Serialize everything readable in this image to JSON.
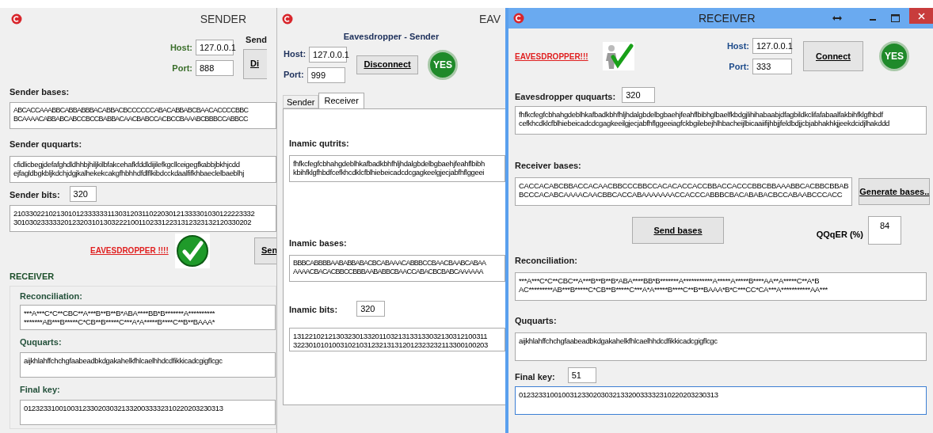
{
  "sender_window": {
    "title": "SENDER",
    "host_label": "Host:",
    "host": "127.0.0.1",
    "port_label": "Port:",
    "port": "888",
    "side_label": "Send",
    "side_button": "Di",
    "bases": {
      "label": "Sender bases:",
      "lines": [
        "ABCACCAAABBCABBABBBACABBACBCCCCCCABACABBABCBAACACCCCBBC",
        "BCAAAACABBABCABCCBCCBABBACAACBABCCACBCCBAAABCBBBCCABBCC"
      ]
    },
    "ququarts": {
      "label": "Sender ququarts:",
      "lines": [
        "cfidlicbegjdefafghdldhhbjhiljkilbfakcehafkfddldijilefkgcllceigegfkabbjbkhjcdd",
        "ejfagldbgkbljkdchjdgjkalhekekcakgfhbhhdfdlflkibdcckdaalfifkhbaeclelbaeblhj"
      ]
    },
    "bits": {
      "label": "Sender bits:",
      "count": "320",
      "lines": [
        "21033022102130101233333311303120311022030121333301030122223332",
        "3010302333332012320310130322210011023312231312323132120330202"
      ]
    },
    "alert": "EAVESDROPPER !!!!",
    "send_button": "Sen",
    "section": "RECEIVER",
    "reconciliation": {
      "label": "Reconciliation:",
      "lines": [
        "***A***C*C**CBC**A***B**B**B*ABA****BB*B*******A**********",
        "*******AB***B*****C*CB**B*****C***A*A*****B****C**B**BAAA*"
      ]
    },
    "ququarts_rx": {
      "label": "Ququarts:",
      "lines": [
        "aijkhlahffchchgfaabeadbkdgakahelkfhlcaelhhdcdfikkicadcgigflcgc"
      ]
    },
    "final_key": {
      "label": "Final key:",
      "lines": [
        "012323310010031233020303213320033332310220203230313"
      ]
    }
  },
  "eavesdropper_window": {
    "title": "EAV",
    "heading": "Eavesdropper - Sender",
    "host_label": "Host:",
    "host": "127.0.0.1",
    "port_label": "Port:",
    "port": "999",
    "button": "Disconnect",
    "badge": "YES",
    "tabs": [
      {
        "label": "Sender",
        "selected": false
      },
      {
        "label": "Receiver",
        "selected": true
      }
    ],
    "qutrits": {
      "label": "Inamic qutrits:",
      "lines": [
        "fhfkcfegfcbhahgdeblhkafbadkbhfhljhdalgbdelbgbaehjfeahflbibh",
        "kbihfklgfhbdfcefkhcdklcfblhiebeicadcdcgagkeelgjecjabfhflggeei"
      ]
    },
    "bases": {
      "label": "Inamic bases:",
      "lines": [
        "BBBCABBBBAABABBABACBCABAAACABBBCCBAACBAABCABAA",
        "AAAACBACACBBCCBBBAABABBCBAACCABACBCBABCAAAAAA"
      ]
    },
    "bits": {
      "label": "Inamic bits:",
      "count": "320",
      "lines": [
        "13122102121303230133201103213133133032130312100311",
        "32230101010031021031232131312012323232113300100203"
      ]
    }
  },
  "receiver_window": {
    "title": "RECEIVER",
    "alert": "EAVESDROPPER!!!",
    "host_label": "Host:",
    "host": "127.0.0.1",
    "port_label": "Port:",
    "port": "333",
    "button": "Connect",
    "badge": "YES",
    "eve_ququarts": {
      "label": "Eavesdropper ququarts:",
      "count": "320",
      "lines": [
        "fhfkcfegfcbhahgdeblhkafbadkbhfhljhdalgbdelbgbaehjfeahflbibhglbaelfkbdgjlihihabaabjdfagbildkclifafabaalfakbihfklgfhbdf",
        "cefkhcdklcfblhiebeicadcdcgagkeeilgjecjabfhflggeeiagfckbgilebejhlhbacheijlbicaaiifijhbjjfeldbdjjcbjabhakhkjjeekdcidjlhakddd"
      ]
    },
    "bases": {
      "label": "Receiver bases:",
      "lines": [
        "CACCACABCBBACCACAACBBCCCBBCCACACACCACCBBACCACCCBBCBBAAABBCACBBCBBAB",
        "BCCCACABCAAAACAACBBCACCABAAAAAAACCACCCABBBCBACABABACBCCABAABCCCACC"
      ]
    },
    "generate_button": "Generate bases..",
    "send_button": "Send bases",
    "qqer_label": "QQqER (%)",
    "qqer": "84",
    "reconciliation": {
      "label": "Reconciliation:",
      "lines": [
        "***A***C*C**CBC**A***B**B**B*ABA****BB*B*******A***********A*****A*****B****AA**A*****C**A*B",
        "AC*********AB***B*****C*CB**B*****C***A*A*****B****C**B**BAAA*B*C***CC*CA***A***********AA***"
      ]
    },
    "ququarts": {
      "label": "Ququarts:",
      "lines": [
        "aijkhlahffchchgfaabeadbkdgakahelkfhlcaelhhdcdfikkicadcgigflcgc"
      ]
    },
    "final_key": {
      "label": "Final key:",
      "count": "51",
      "lines": [
        "012323310010031233020303213320033332310220203230313"
      ]
    }
  }
}
